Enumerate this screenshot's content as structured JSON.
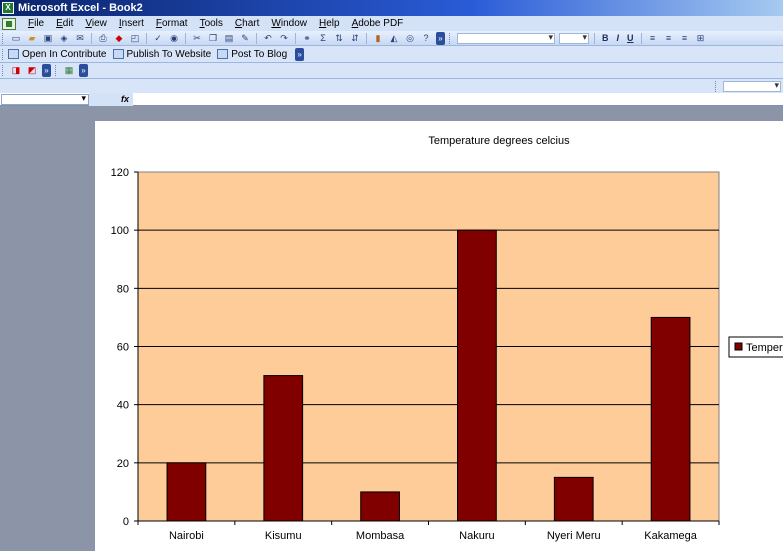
{
  "window": {
    "title": "Microsoft Excel - Book2"
  },
  "menu": {
    "items": [
      "File",
      "Edit",
      "View",
      "Insert",
      "Format",
      "Tools",
      "Chart",
      "Window",
      "Help",
      "Adobe PDF"
    ]
  },
  "toolbar2": {
    "open_in_contribute": "Open In Contribute",
    "publish_to_website": "Publish To Website",
    "post_to_blog": "Post To Blog"
  },
  "formula_bar": {
    "fx": "fx"
  },
  "icons": {
    "new": "new-doc-icon",
    "open": "open-folder-icon",
    "save": "save-icon",
    "print": "print-icon",
    "bold": "B",
    "italic": "I",
    "underline": "U",
    "sigma": "Σ"
  },
  "colors": {
    "plot_bg": "#fecc99",
    "bar": "#800000",
    "title_bar": "#0a246a"
  },
  "chart_data": {
    "type": "bar",
    "title": "Temperature degrees celcius",
    "categories": [
      "Nairobi",
      "Kisumu",
      "Mombasa",
      "Nakuru",
      "Nyeri Meru",
      "Kakamega"
    ],
    "series": [
      {
        "name": "Temper",
        "values": [
          20,
          50,
          10,
          100,
          15,
          70
        ]
      }
    ],
    "ylim": [
      0,
      120
    ],
    "yticks": [
      0,
      20,
      40,
      60,
      80,
      100,
      120
    ],
    "grid": true,
    "legend": "right"
  }
}
